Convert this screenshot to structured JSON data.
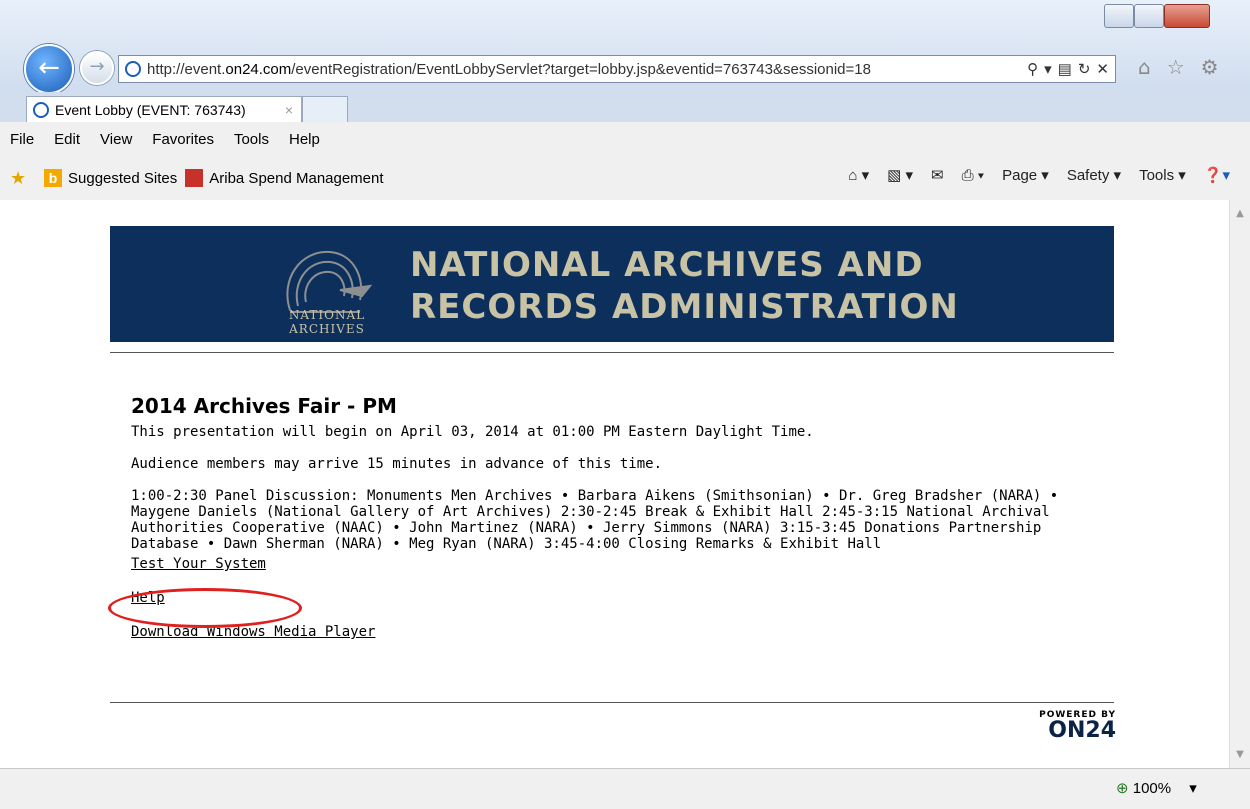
{
  "browser": {
    "address_url_prefix": "http://event.",
    "address_url_domain": "on24.com",
    "address_url_suffix": "/eventRegistration/EventLobbyServlet?target=lobby.jsp&eventid=763743&sessionid=18",
    "tab_title": "Event Lobby (EVENT: 763743)",
    "tab_close": "×",
    "zoom": "100%"
  },
  "menu": {
    "file": "File",
    "edit": "Edit",
    "view": "View",
    "favorites": "Favorites",
    "tools": "Tools",
    "help": "Help"
  },
  "favorites_bar": {
    "item1": "Suggested Sites",
    "item2": "Ariba Spend Management"
  },
  "command_bar": {
    "page": "Page ▾",
    "safety": "Safety ▾",
    "tools": "Tools ▾"
  },
  "banner": {
    "seal_text_line1": "NATIONAL",
    "seal_text_line2": "ARCHIVES",
    "title_line1": "NATIONAL ARCHIVES AND",
    "title_line2": "RECORDS ADMINISTRATION"
  },
  "event": {
    "title": "2014 Archives Fair - PM",
    "begin_line": "This presentation will begin on April 03, 2014 at 01:00 PM Eastern Daylight Time.",
    "arrive_line": "Audience members may arrive 15 minutes in advance of this time.",
    "agenda": "1:00-2:30 Panel Discussion: Monuments Men Archives • Barbara Aikens (Smithsonian) • Dr. Greg Bradsher (NARA) • Maygene Daniels (National Gallery of Art Archives) 2:30-2:45 Break & Exhibit Hall 2:45-3:15 National Archival Authorities Cooperative (NAAC) • John Martinez (NARA) • Jerry Simmons (NARA) 3:15-3:45 Donations Partnership Database • Dawn Sherman (NARA) • Meg Ryan (NARA) 3:45-4:00 Closing Remarks & Exhibit Hall"
  },
  "links": {
    "test_system": "Test Your System",
    "help": "Help",
    "download_wmp": "Download Windows Media Player"
  },
  "footer": {
    "powered_by": "POWERED BY",
    "brand": "ON24"
  }
}
